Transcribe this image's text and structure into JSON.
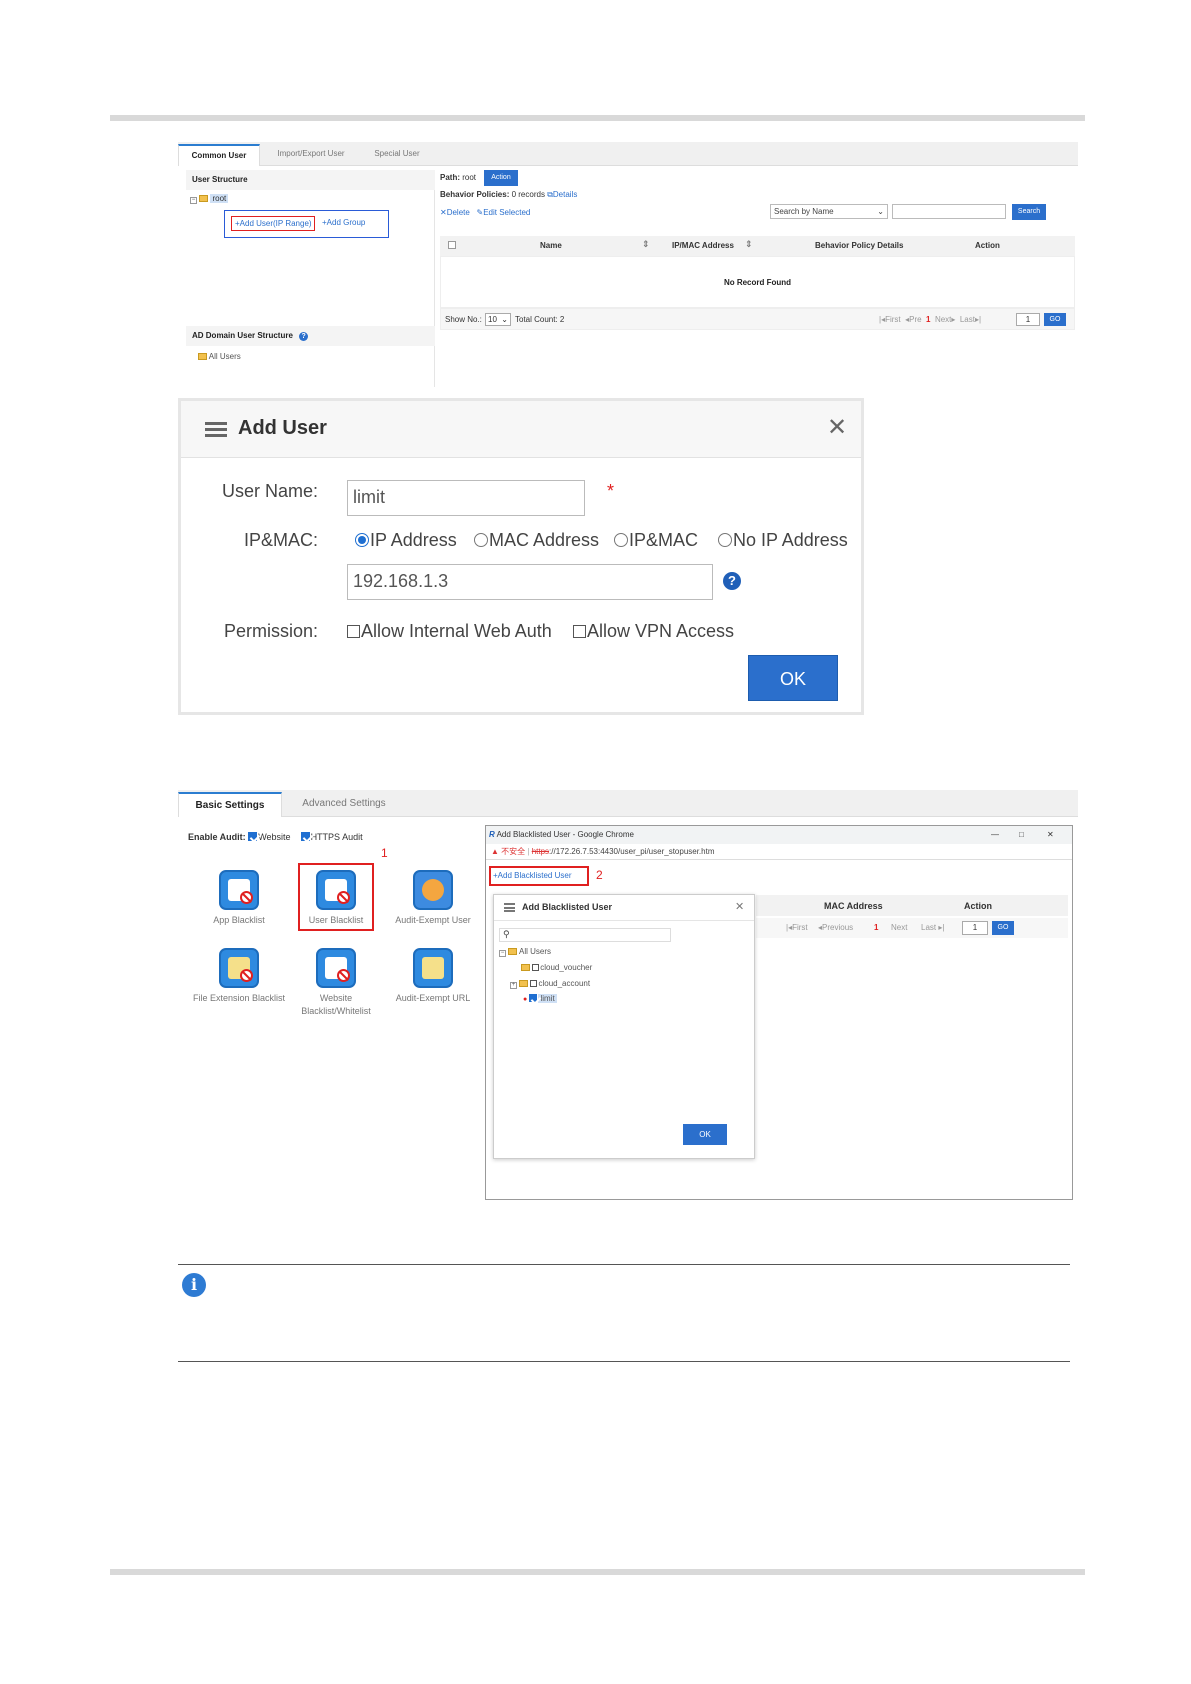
{
  "screen1": {
    "tabs": [
      "Common User",
      "Import/Export User",
      "Special User"
    ],
    "user_structure_title": "User Structure",
    "root_node": "root",
    "add_user_button": "Add User(IP Range)",
    "add_group_button": "Add Group",
    "ad_domain_title": "AD Domain User Structure",
    "all_users_node": "All Users",
    "path_label": "Path:",
    "path_value": "root",
    "action_button": "Action",
    "behavior_label": "Behavior Policies:",
    "behavior_value": "0 records",
    "details_link": "Details",
    "delete_button": "Delete",
    "edit_selected_button": "Edit Selected",
    "search_select": "Search by Name",
    "search_button": "Search",
    "columns": [
      "Name",
      "IP/MAC Address",
      "Behavior Policy Details",
      "Action"
    ],
    "no_record": "No Record Found",
    "show_no_label": "Show No.:",
    "show_no_value": "10",
    "total_count": "Total Count: 2",
    "pager": {
      "first": "First",
      "pre": "Pre",
      "current": "1",
      "next": "Next",
      "last": "Last",
      "page_input": "1",
      "go": "GO"
    }
  },
  "dialog": {
    "title": "Add User",
    "username_label": "User Name:",
    "username_value": "limit",
    "required_mark": "*",
    "ipmac_label": "IP&MAC:",
    "options": [
      "IP Address",
      "MAC Address",
      "IP&MAC",
      "No IP Address"
    ],
    "selected_option": "IP Address",
    "ip_value": "192.168.1.3",
    "permission_label": "Permission:",
    "permissions": [
      "Allow Internal Web Auth",
      "Allow VPN Access"
    ],
    "ok_button": "OK"
  },
  "screen3": {
    "tabs": [
      "Basic Settings",
      "Advanced Settings"
    ],
    "enable_audit_label": "Enable Audit:",
    "audit_website": "Website",
    "audit_https": "HTTPS Audit",
    "callout_1": "1",
    "callout_2": "2",
    "tiles": [
      "App Blacklist",
      "User Blacklist",
      "Audit-Exempt User",
      "File Extension Blacklist",
      "Website Blacklist/Whitelist",
      "Audit-Exempt URL"
    ],
    "chrome_title": "Add Blacklisted User - Google Chrome",
    "insecure_label": "不安全",
    "url_scheme": "https",
    "url_rest": "://172.26.7.53:4430/user_pi/user_stopuser.htm",
    "add_blacklisted_button": "Add Blacklisted User",
    "inner_columns": [
      "MAC Address",
      "Action"
    ],
    "pager": {
      "first": "First",
      "previous": "Previous",
      "current": "1",
      "next": "Next",
      "last": "Last",
      "page_input": "1",
      "go": "GO"
    },
    "inner_dialog_title": "Add Blacklisted User",
    "tree": {
      "root": "All Users",
      "children": [
        "cloud_voucher",
        "cloud_account",
        "limit"
      ]
    },
    "ok_button": "OK"
  },
  "colors": {
    "accent": "#2b6fcc",
    "callout": "#e02020",
    "highlight_box": "#2a5bd7"
  }
}
